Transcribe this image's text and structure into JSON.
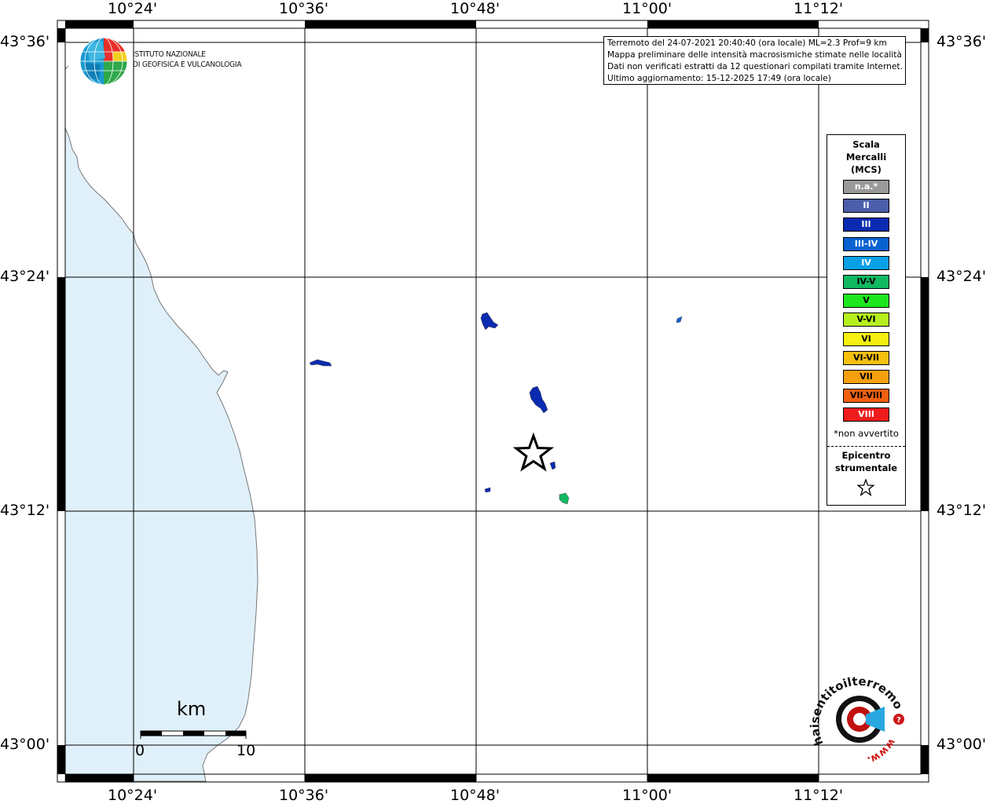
{
  "map": {
    "top_lon_labels": [
      "10°24'",
      "10°36'",
      "10°48'",
      "11°00'",
      "11°12'"
    ],
    "bottom_lon_labels": [
      "10°24'",
      "10°36'",
      "10°48'",
      "11°00'",
      "11°12'"
    ],
    "left_lat_labels": [
      "43°36'",
      "43°24'",
      "43°12'",
      "43°00'"
    ],
    "right_lat_labels": [
      "43°36'",
      "43°24'",
      "43°12'",
      "43°00'"
    ],
    "sea_color": "#e0f0fa",
    "grid_color": "#000000"
  },
  "info": {
    "line1": "Terremoto del 24-07-2021 20:40:40 (ora locale) ML=2.3 Prof=9 km",
    "line2": "Mappa preliminare delle intensità macrosismiche stimate nelle località",
    "line3": "Dati non verificati estratti da 12 questionari compilati tramite Internet.",
    "line4": "Ultimo aggiornamento: 15-12-2025 17:49 (ora locale)"
  },
  "logo_ingv": {
    "line1": "ISTITUTO NAZIONALE",
    "line2": "DI GEOFISICA E VULCANOLOGIA"
  },
  "legend": {
    "title_line1": "Scala",
    "title_line2": "Mercalli",
    "title_line3": "(MCS)",
    "items": [
      {
        "label": "n.a.*",
        "color": "#9a9a9a"
      },
      {
        "label": "II",
        "color": "#4a5eaa"
      },
      {
        "label": "III",
        "color": "#0a2bb0"
      },
      {
        "label": "III-IV",
        "color": "#0a62d0"
      },
      {
        "label": "IV",
        "color": "#0aa0e6"
      },
      {
        "label": "IV-V",
        "color": "#10b860"
      },
      {
        "label": "V",
        "color": "#1ee61e"
      },
      {
        "label": "V-VI",
        "color": "#b4f01e"
      },
      {
        "label": "VI",
        "color": "#f6f010"
      },
      {
        "label": "VI-VII",
        "color": "#f6c010"
      },
      {
        "label": "VII",
        "color": "#f6a010"
      },
      {
        "label": "VII-VIII",
        "color": "#f06010"
      },
      {
        "label": "VIII",
        "color": "#ee1c1c"
      }
    ],
    "note": "*non avvertito",
    "epicentro_line1": "Epicentro",
    "epicentro_line2": "strumentale"
  },
  "scale_bar": {
    "unit": "km",
    "start": "0",
    "end": "10"
  },
  "hst_logo": {
    "text_main": "haisentitoilterremoto.it",
    "text_www": "www."
  }
}
